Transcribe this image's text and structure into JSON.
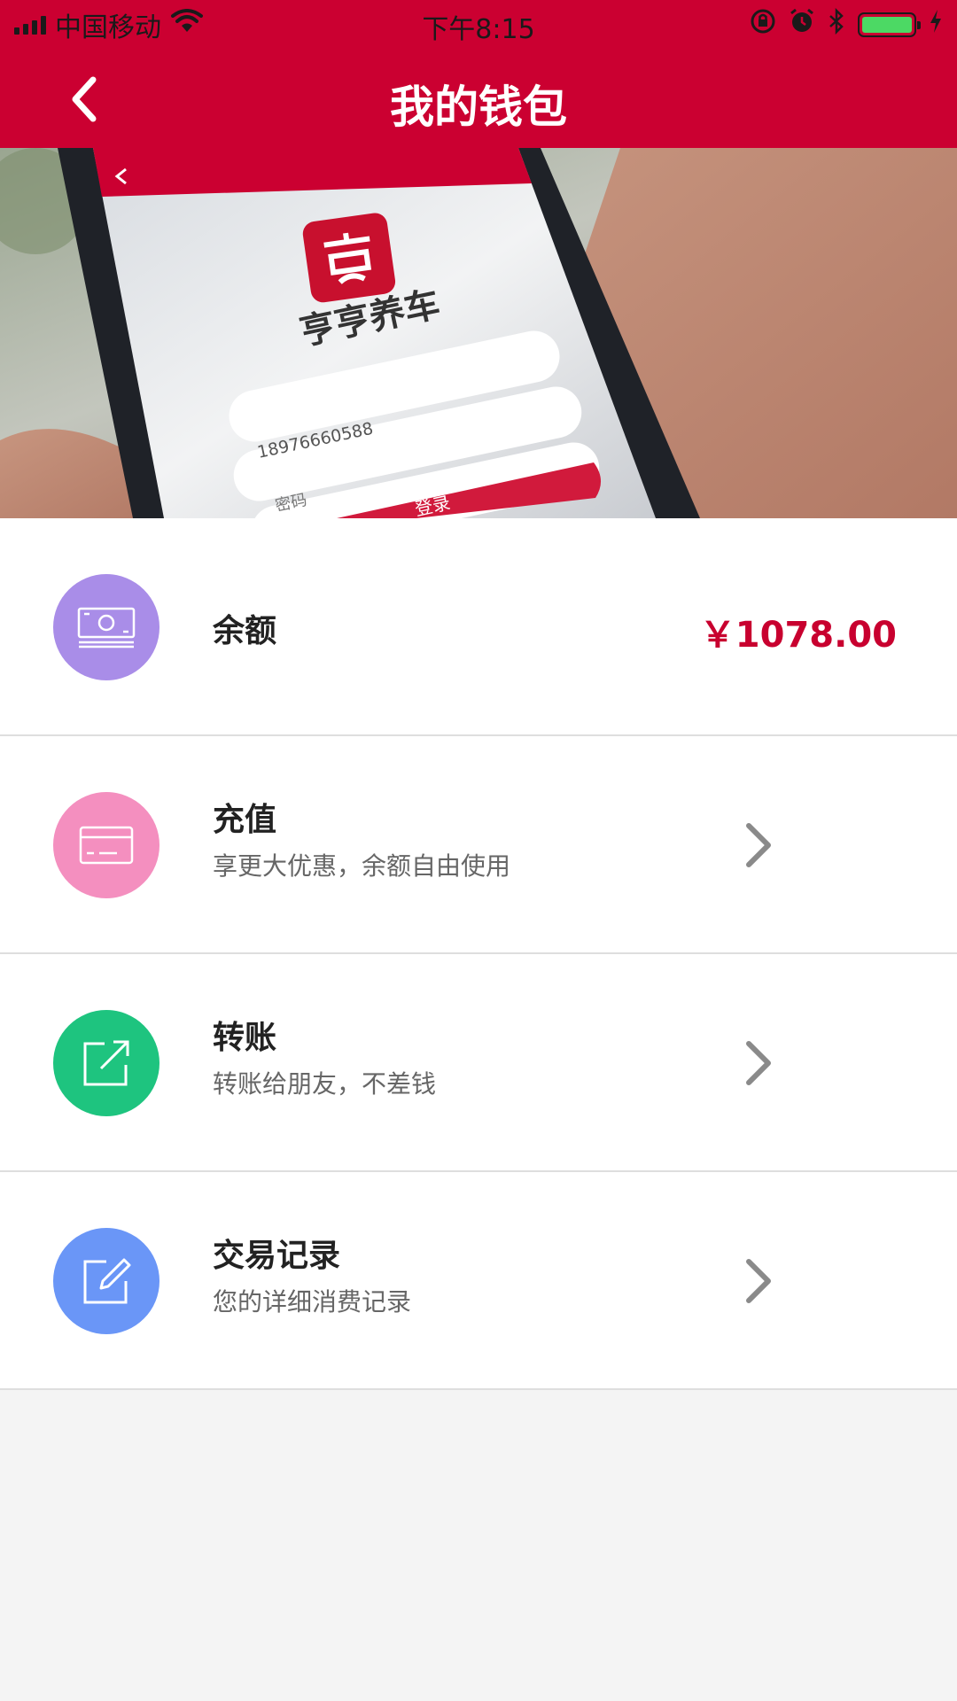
{
  "status_bar": {
    "carrier": "中国移动",
    "time": "下午8:15",
    "battery_color": "#4cd964"
  },
  "nav": {
    "title": "我的钱包",
    "back_icon": "chevron-left-icon"
  },
  "banner": {
    "app_name": "亨亨养车",
    "phone_value": "18976660588",
    "password_placeholder": "密码",
    "login_label": "登录"
  },
  "wallet": {
    "balance": {
      "label": "余额",
      "amount": "￥1078.00",
      "icon": "cash-icon",
      "color": "#a98de8"
    },
    "items": [
      {
        "title": "充值",
        "subtitle": "享更大优惠，余额自由使用",
        "icon": "card-icon",
        "color": "#f48fbf"
      },
      {
        "title": "转账",
        "subtitle": "转账给朋友，不差钱",
        "icon": "share-icon",
        "color": "#1ec47f"
      },
      {
        "title": "交易记录",
        "subtitle": "您的详细消费记录",
        "icon": "edit-icon",
        "color": "#6a96f7"
      }
    ]
  },
  "colors": {
    "brand_red": "#cb0031",
    "amount_red": "#c8002f"
  }
}
